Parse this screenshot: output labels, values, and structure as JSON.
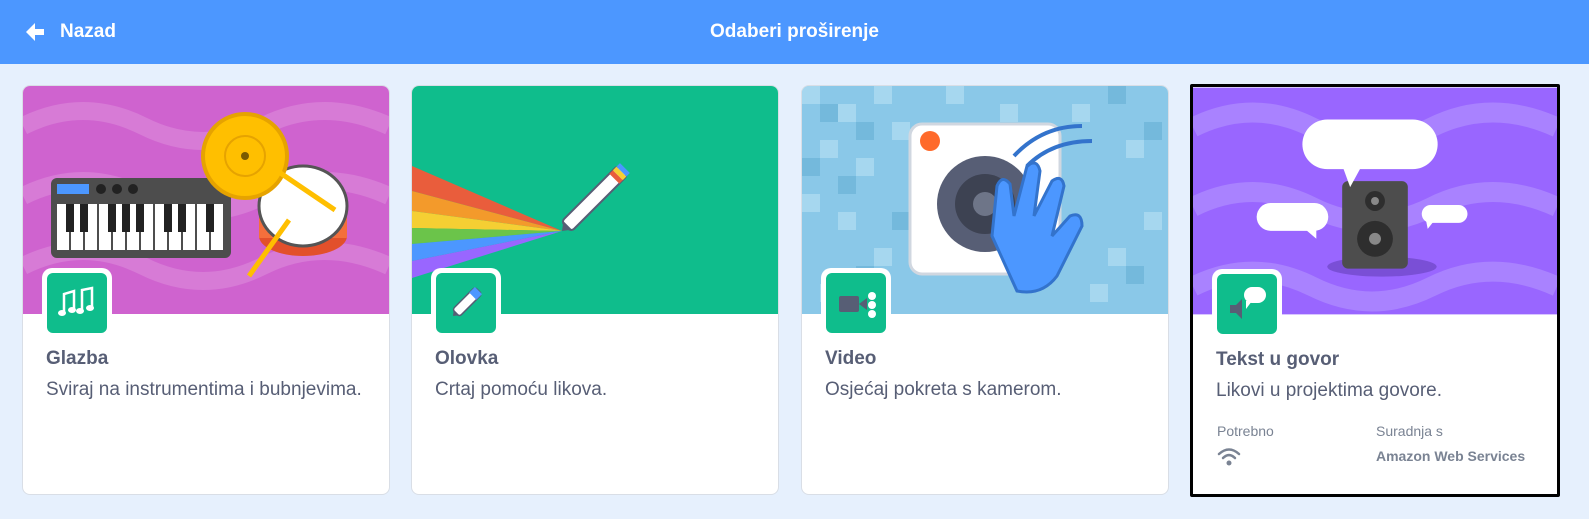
{
  "header": {
    "back_label": "Nazad",
    "title": "Odaberi proširenje"
  },
  "colors": {
    "header": "#4c97ff",
    "background": "#e6f0fd",
    "badge": "#0fbd8c",
    "text": "#575e75"
  },
  "extensions": [
    {
      "name": "Glazba",
      "description": "Sviraj na instrumentima i bubnjevima.",
      "icon": "music-notes-icon"
    },
    {
      "name": "Olovka",
      "description": "Crtaj pomoću likova.",
      "icon": "pen-icon"
    },
    {
      "name": "Video",
      "description": "Osjećaj pokreta s kamerom.",
      "icon": "video-camera-icon"
    },
    {
      "name": "Tekst u govor",
      "description": "Likovi u projektima govore.",
      "icon": "speaker-speech-icon",
      "requires_label": "Potrebno",
      "requires_icon": "wifi-icon",
      "collaboration_label": "Suradnja s",
      "collaborator": "Amazon Web Services",
      "selected": true
    }
  ]
}
